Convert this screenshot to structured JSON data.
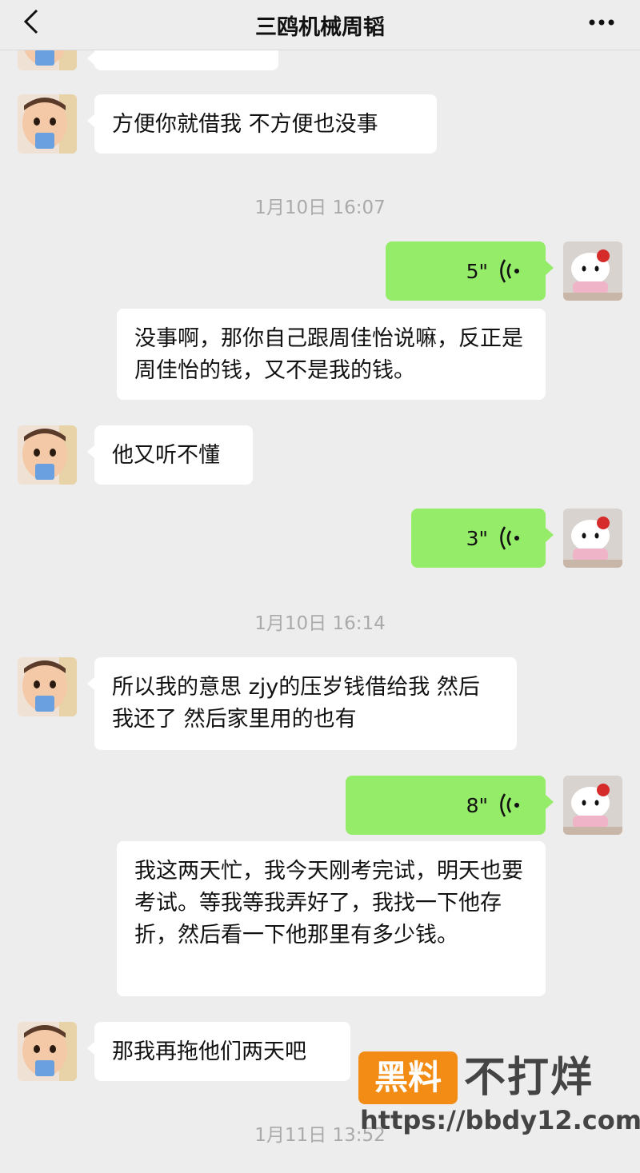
{
  "header": {
    "title": "三鸥机械周韬"
  },
  "messages": {
    "m1": {
      "text": "方便你就借我 不方便也没事"
    },
    "t1": {
      "time": "1月10日 16:07"
    },
    "v1": {
      "duration": "5\"",
      "transcript": "没事啊，那你自己跟周佳怡说嘛，反正是周佳怡的钱，又不是我的钱。"
    },
    "m2": {
      "text": "他又听不懂"
    },
    "v2": {
      "duration": "3\""
    },
    "t2": {
      "time": "1月10日 16:14"
    },
    "m3": {
      "text": "所以我的意思 zjy的压岁钱借给我 然后我还了 然后家里用的也有"
    },
    "v3": {
      "duration": "8\"",
      "transcript": "我这两天忙，我今天刚考完试，明天也要考试。等我等我弄好了，我找一下他存折，然后看一下他那里有多少钱。"
    },
    "m4": {
      "text": "那我再拖他们两天吧"
    },
    "t3": {
      "time": "1月11日 13:52"
    }
  },
  "watermark": {
    "badge": "黑料",
    "text": "不打烊",
    "url": "https://bbdy12.com"
  },
  "icons": {
    "back": "chevron-left-icon",
    "more": "more-dots-icon",
    "voice": "voice-wave-icon"
  },
  "colors": {
    "background": "#ededed",
    "bubble_in": "#ffffff",
    "bubble_voice": "#95ec69",
    "watermark": "#f28c15"
  }
}
